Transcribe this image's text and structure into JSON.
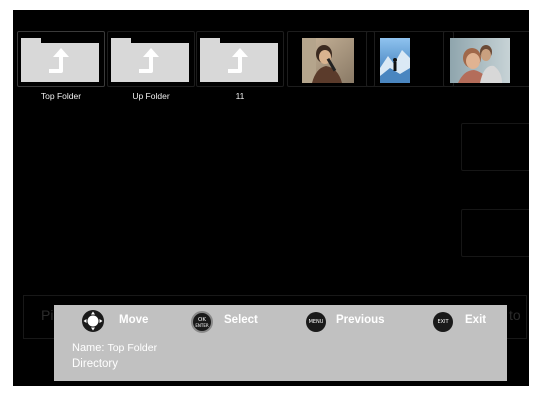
{
  "browser": {
    "items": [
      {
        "label": "Top Folder",
        "kind": "folder"
      },
      {
        "label": "Up Folder",
        "kind": "folder"
      },
      {
        "label": "11",
        "kind": "folder"
      },
      {
        "label": "",
        "kind": "photo"
      },
      {
        "label": "",
        "kind": "photo"
      },
      {
        "label": "",
        "kind": "photo"
      }
    ]
  },
  "background_letters": {
    "left": "Pi",
    "right": "to"
  },
  "controls": {
    "move_label": "Move",
    "select_label": "Select",
    "previous_label": "Previous",
    "exit_label": "Exit",
    "ok_icon_text": "OK",
    "ok_icon_subtext": "ENTER",
    "menu_icon_text": "MENU",
    "exit_icon_text": "EXIT"
  },
  "info": {
    "name_label": "Name:",
    "name_value": "Top Folder",
    "type": "Directory"
  },
  "colors": {
    "screen_bg": "#000000",
    "panel_bg": "#c1c1c1",
    "folder": "#d8d8d8"
  }
}
